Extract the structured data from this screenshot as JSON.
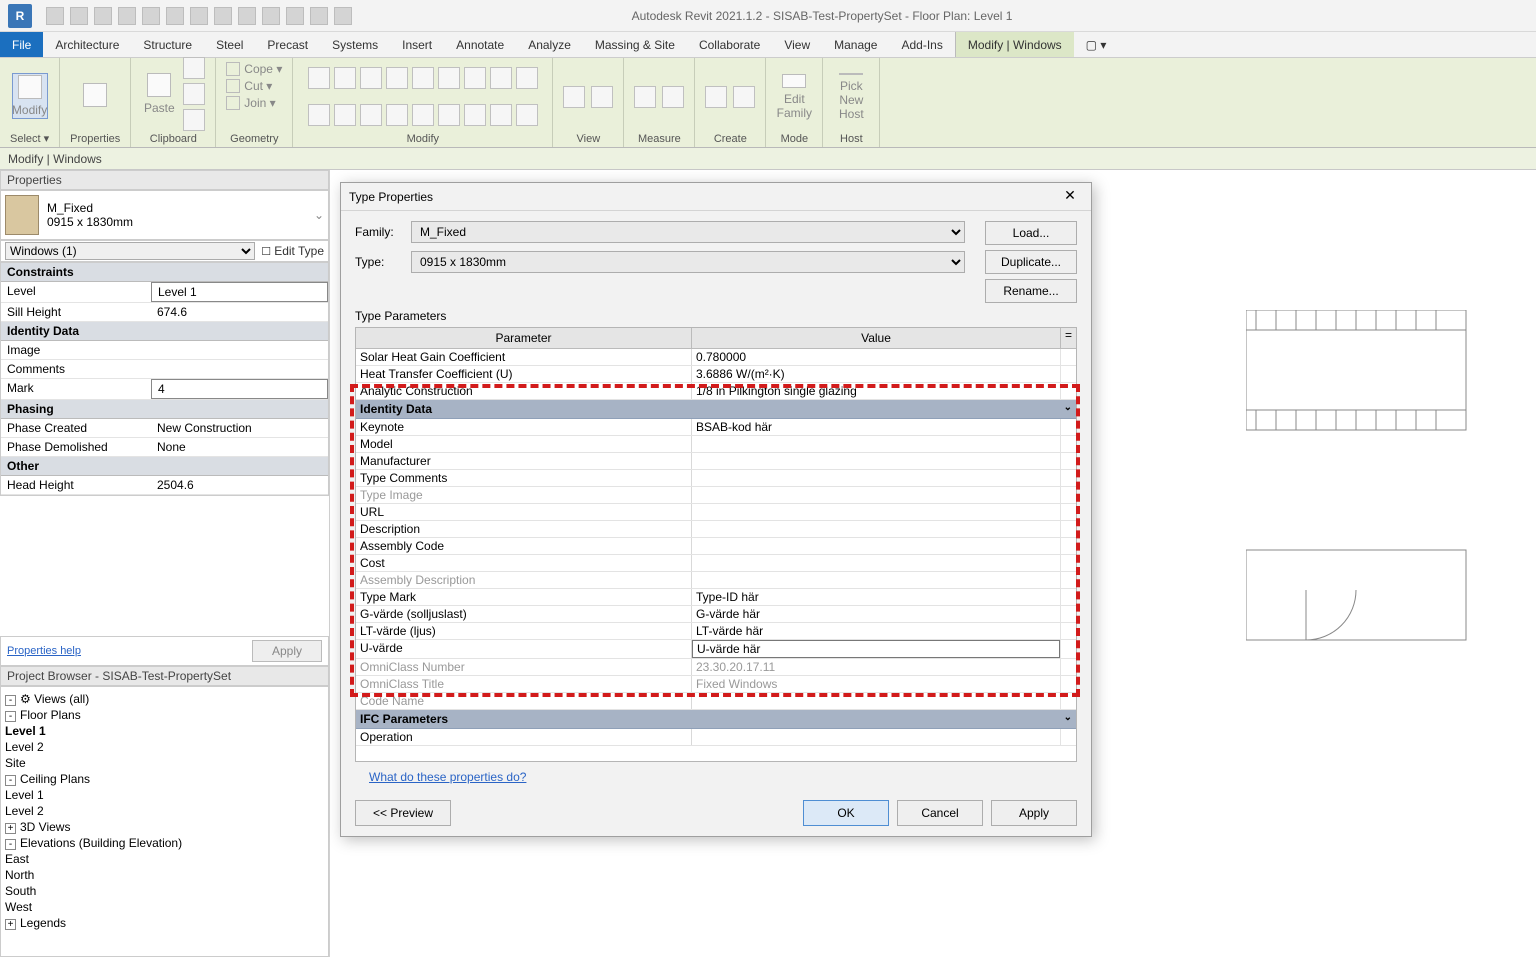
{
  "app": {
    "title": "Autodesk Revit 2021.1.2 - SISAB-Test-PropertySet - Floor Plan: Level 1"
  },
  "ribbon": {
    "tabs": [
      "File",
      "Architecture",
      "Structure",
      "Steel",
      "Precast",
      "Systems",
      "Insert",
      "Annotate",
      "Analyze",
      "Massing & Site",
      "Collaborate",
      "View",
      "Manage",
      "Add-Ins",
      "Modify | Windows"
    ],
    "groups": {
      "select": "Select ▾",
      "properties": "Properties",
      "clipboard": "Clipboard",
      "geometry": "Geometry",
      "modify": "Modify",
      "view": "View",
      "measure": "Measure",
      "create": "Create",
      "mode": "Mode",
      "host": "Host"
    },
    "modify_big": "Modify",
    "paste": "Paste",
    "edit_family": "Edit\nFamily",
    "pick_host": "Pick\nNew Host",
    "clip": {
      "cope": "Cope ▾",
      "cut": "Cut ▾",
      "join": "Join ▾"
    }
  },
  "modifyBar": "Modify | Windows",
  "docTab": "Level 1",
  "properties": {
    "title": "Properties",
    "type_name": "M_Fixed",
    "type_size": "0915 x 1830mm",
    "category": "Windows (1)",
    "edit_type": "Edit Type",
    "sections": {
      "constraints": {
        "label": "Constraints",
        "rows": [
          [
            "Level",
            "Level 1"
          ],
          [
            "Sill Height",
            "674.6"
          ]
        ]
      },
      "identity": {
        "label": "Identity Data",
        "rows": [
          [
            "Image",
            ""
          ],
          [
            "Comments",
            ""
          ],
          [
            "Mark",
            "4"
          ]
        ]
      },
      "phasing": {
        "label": "Phasing",
        "rows": [
          [
            "Phase Created",
            "New Construction"
          ],
          [
            "Phase Demolished",
            "None"
          ]
        ]
      },
      "other": {
        "label": "Other",
        "rows": [
          [
            "Head Height",
            "2504.6"
          ]
        ]
      }
    },
    "help": "Properties help",
    "apply": "Apply"
  },
  "browser": {
    "title": "Project Browser - SISAB-Test-PropertySet",
    "root": "Views (all)",
    "nodes": {
      "floor": "Floor Plans",
      "lvl1": "Level 1",
      "lvl2": "Level 2",
      "site": "Site",
      "ceiling": "Ceiling Plans",
      "c1": "Level 1",
      "c2": "Level 2",
      "tv": "3D Views",
      "elev": "Elevations (Building Elevation)",
      "e_e": "East",
      "e_n": "North",
      "e_s": "South",
      "e_w": "West",
      "legends": "Legends"
    }
  },
  "dialog": {
    "title": "Type Properties",
    "family_label": "Family:",
    "family": "M_Fixed",
    "type_label": "Type:",
    "type": "0915 x 1830mm",
    "load": "Load...",
    "duplicate": "Duplicate...",
    "rename": "Rename...",
    "subhead": "Type Parameters",
    "col_param": "Parameter",
    "col_value": "Value",
    "rows": [
      {
        "k": "Solar Heat Gain Coefficient",
        "v": "0.780000"
      },
      {
        "k": "Heat Transfer Coefficient (U)",
        "v": "3.6886 W/(m²·K)"
      },
      {
        "k": "Analytic Construction",
        "v": "1/8 in Pilkington single glazing"
      }
    ],
    "cat_identity": "Identity Data",
    "identity_rows": [
      {
        "k": "Keynote",
        "v": "BSAB-kod här"
      },
      {
        "k": "Model",
        "v": ""
      },
      {
        "k": "Manufacturer",
        "v": ""
      },
      {
        "k": "Type Comments",
        "v": ""
      },
      {
        "k": "Type Image",
        "v": "",
        "grey": true
      },
      {
        "k": "URL",
        "v": ""
      },
      {
        "k": "Description",
        "v": ""
      },
      {
        "k": "Assembly Code",
        "v": ""
      },
      {
        "k": "Cost",
        "v": ""
      },
      {
        "k": "Assembly Description",
        "v": "",
        "grey": true
      },
      {
        "k": "Type Mark",
        "v": "Type-ID här"
      },
      {
        "k": "G-värde (solljuslast)",
        "v": "G-värde här"
      },
      {
        "k": "LT-värde (ljus)",
        "v": "LT-värde här"
      },
      {
        "k": "U-värde",
        "v": "U-värde här",
        "sel": true
      },
      {
        "k": "OmniClass Number",
        "v": "23.30.20.17.11",
        "grey": true
      },
      {
        "k": "OmniClass Title",
        "v": "Fixed Windows",
        "grey": true
      },
      {
        "k": "Code Name",
        "v": "",
        "grey": true
      }
    ],
    "cat_ifc": "IFC Parameters",
    "ifc_rows": [
      {
        "k": "Operation",
        "v": ""
      }
    ],
    "help": "What do these properties do?",
    "preview": "<< Preview",
    "ok": "OK",
    "cancel": "Cancel",
    "apply": "Apply"
  }
}
